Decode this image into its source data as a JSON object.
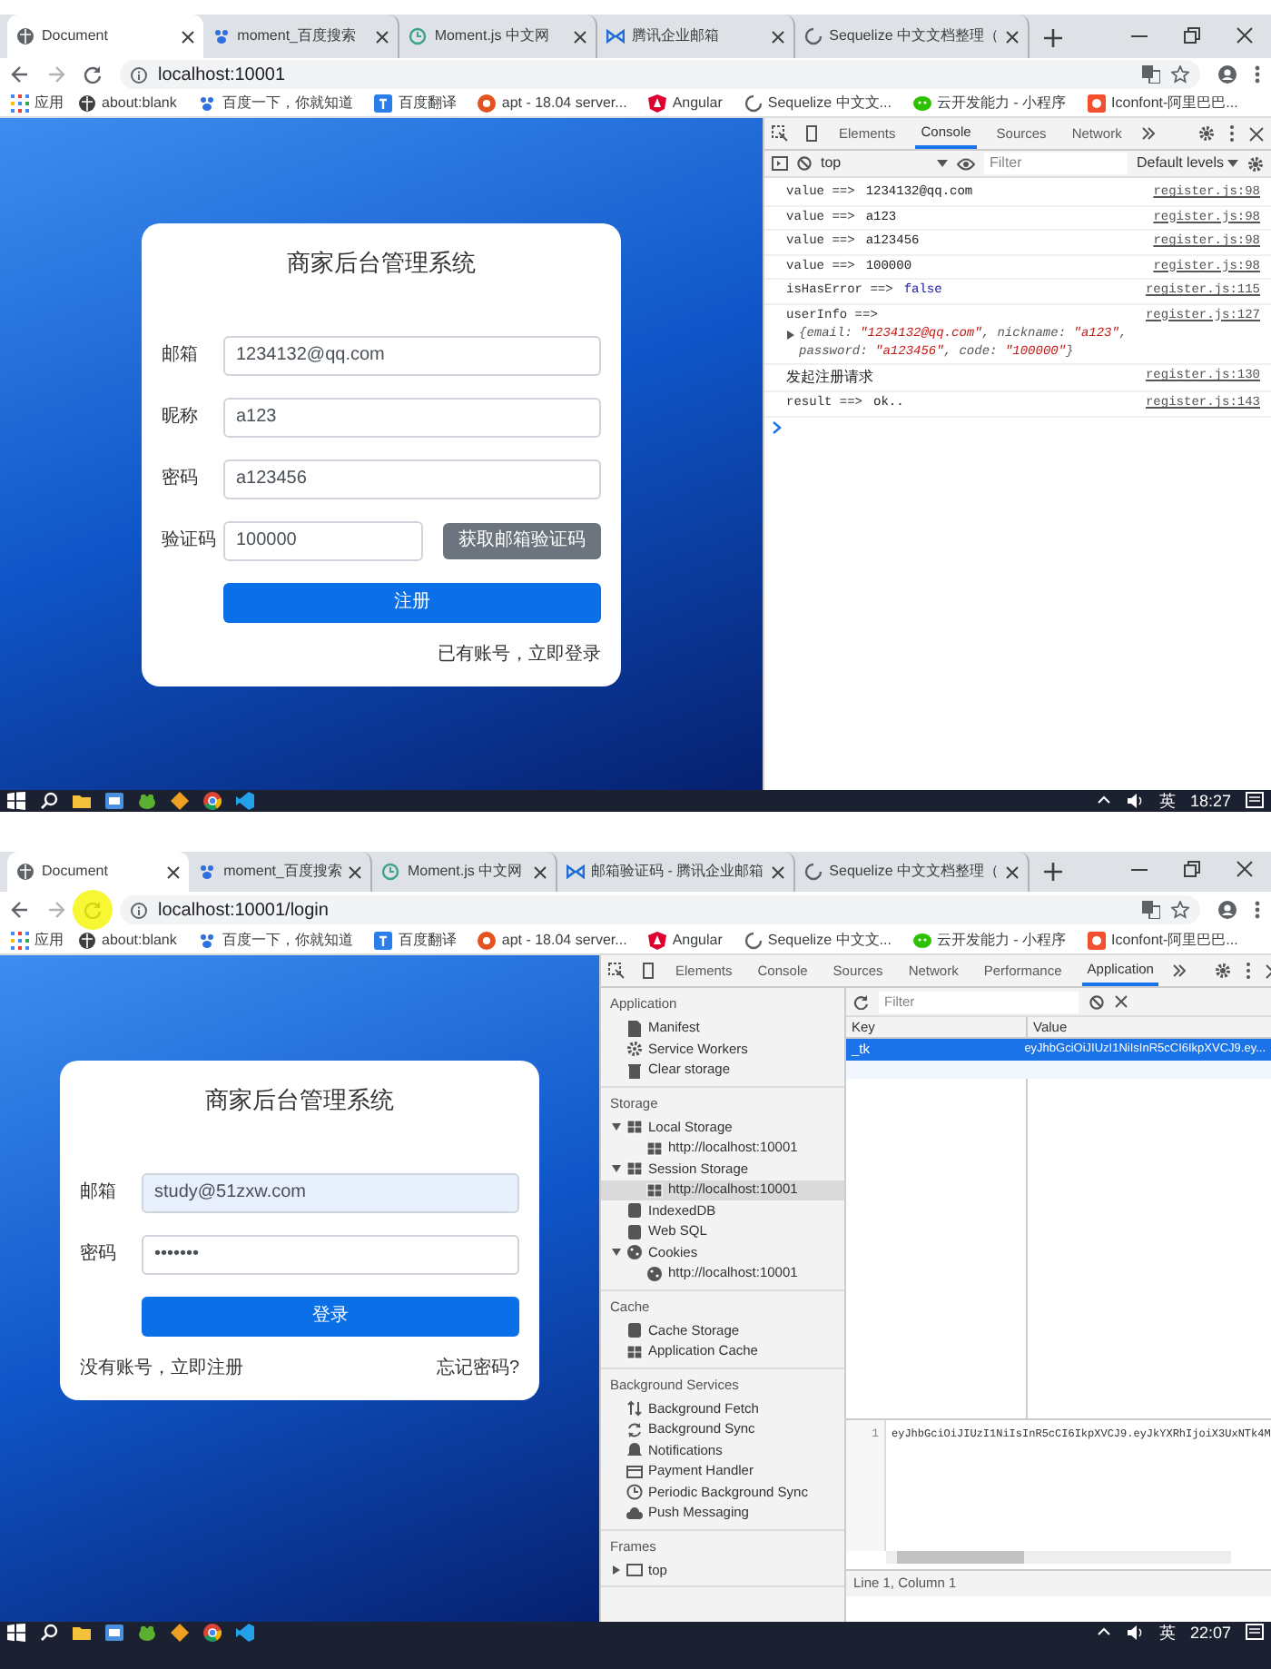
{
  "screens": [
    {
      "tabs": [
        {
          "label": "Document",
          "selected": true
        },
        {
          "label": "moment_百度搜索",
          "selected": false
        },
        {
          "label": "Moment.js 中文网",
          "selected": false
        },
        {
          "label": "腾讯企业邮箱",
          "selected": false
        },
        {
          "label": "Sequelize 中文文档整理（",
          "selected": false
        }
      ],
      "url": "localhost:10001",
      "cursor_highlight": false,
      "bookmarks": [
        "应用",
        "about:blank",
        "百度一下，你就知道",
        "百度翻译",
        "apt - 18.04 server...",
        "Angular",
        "Sequelize 中文文...",
        "云开发能力 - 小程序",
        "Iconfont-阿里巴巴..."
      ],
      "form": {
        "title": "商家后台管理系统",
        "fields": [
          {
            "kind": "text",
            "label": "邮箱",
            "value": "1234132@qq.com",
            "autofilled": false
          },
          {
            "kind": "text",
            "label": "昵称",
            "value": "a123",
            "autofilled": false
          },
          {
            "kind": "text",
            "label": "密码",
            "value": "a123456",
            "autofilled": false
          },
          {
            "kind": "code",
            "label": "验证码",
            "value": "100000",
            "button": "获取邮箱验证码",
            "autofilled": false
          }
        ],
        "submit": "注册",
        "links": [
          "已有账号，立即登录"
        ]
      },
      "devtools": {
        "kind": "console",
        "tabs": [
          {
            "label": "Elements",
            "selected": false
          },
          {
            "label": "Console",
            "selected": true
          },
          {
            "label": "Sources",
            "selected": false
          },
          {
            "label": "Network",
            "selected": false
          }
        ],
        "context": "top",
        "filter_placeholder": "Filter",
        "levels": "Default levels",
        "lines": [
          {
            "kind": "value",
            "label": "value ==>",
            "value": "1234132@qq.com",
            "source": "register.js:98"
          },
          {
            "kind": "value",
            "label": "value ==>",
            "value": "a123",
            "source": "register.js:98"
          },
          {
            "kind": "value",
            "label": "value ==>",
            "value": "a123456",
            "source": "register.js:98"
          },
          {
            "kind": "value",
            "label": "value ==>",
            "value": "100000",
            "source": "register.js:98"
          },
          {
            "kind": "boolean",
            "label": "isHasError ==>",
            "value": "false",
            "source": "register.js:115"
          },
          {
            "kind": "object",
            "label": "userInfo ==>",
            "expanded": false,
            "preview": "{email: \"1234132@qq.com\", nickname: \"a123\", password: \"a123456\", code: \"100000\"}",
            "source": "register.js:127"
          },
          {
            "kind": "message",
            "text": "发起注册请求",
            "source": "register.js:130"
          },
          {
            "kind": "value",
            "label": "result ==>",
            "value": "ok..",
            "source": "register.js:143"
          }
        ]
      },
      "taskbar": {
        "ime": "英",
        "time": "18:27"
      }
    },
    {
      "tabs": [
        {
          "label": "Document",
          "selected": true
        },
        {
          "label": "moment_百度搜索",
          "selected": false
        },
        {
          "label": "Moment.js 中文网",
          "selected": false
        },
        {
          "label": "邮箱验证码 - 腾讯企业邮箱",
          "selected": false
        },
        {
          "label": "Sequelize 中文文档整理（",
          "selected": false
        }
      ],
      "url": "localhost:10001/login",
      "cursor_highlight": true,
      "bookmarks": [
        "应用",
        "about:blank",
        "百度一下，你就知道",
        "百度翻译",
        "apt - 18.04 server...",
        "Angular",
        "Sequelize 中文文...",
        "云开发能力 - 小程序",
        "Iconfont-阿里巴巴..."
      ],
      "form": {
        "title": "商家后台管理系统",
        "fields": [
          {
            "kind": "text",
            "label": "邮箱",
            "value": "study@51zxw.com",
            "autofilled": true
          },
          {
            "kind": "password",
            "label": "密码",
            "value": "•••••••",
            "autofilled": false
          }
        ],
        "submit": "登录",
        "links": [
          "没有账号，立即注册",
          "忘记密码?"
        ]
      },
      "devtools": {
        "kind": "application",
        "tabs": [
          {
            "label": "Elements",
            "selected": false
          },
          {
            "label": "Console",
            "selected": false
          },
          {
            "label": "Sources",
            "selected": false
          },
          {
            "label": "Network",
            "selected": false
          },
          {
            "label": "Performance",
            "selected": false
          },
          {
            "label": "Application",
            "selected": true
          }
        ],
        "sections": [
          {
            "title": "Application",
            "items": [
              {
                "label": "Manifest",
                "selected": false
              },
              {
                "label": "Service Workers",
                "selected": false
              },
              {
                "label": "Clear storage",
                "selected": false
              }
            ]
          },
          {
            "title": "Storage",
            "items": [
              {
                "label": "Local Storage",
                "selected": false,
                "expanded": true,
                "children": [
                  {
                    "label": "http://localhost:10001",
                    "selected": false
                  }
                ]
              },
              {
                "label": "Session Storage",
                "selected": false,
                "expanded": true,
                "children": [
                  {
                    "label": "http://localhost:10001",
                    "selected": true
                  }
                ]
              },
              {
                "label": "IndexedDB",
                "selected": false
              },
              {
                "label": "Web SQL",
                "selected": false
              },
              {
                "label": "Cookies",
                "selected": false,
                "expanded": true,
                "children": [
                  {
                    "label": "http://localhost:10001",
                    "selected": false
                  }
                ]
              }
            ]
          },
          {
            "title": "Cache",
            "items": [
              {
                "label": "Cache Storage",
                "selected": false
              },
              {
                "label": "Application Cache",
                "selected": false
              }
            ]
          },
          {
            "title": "Background Services",
            "items": [
              {
                "label": "Background Fetch",
                "selected": false
              },
              {
                "label": "Background Sync",
                "selected": false
              },
              {
                "label": "Notifications",
                "selected": false
              },
              {
                "label": "Payment Handler",
                "selected": false
              },
              {
                "label": "Periodic Background Sync",
                "selected": false
              },
              {
                "label": "Push Messaging",
                "selected": false
              }
            ]
          },
          {
            "title": "Frames",
            "items": [
              {
                "label": "top",
                "selected": false,
                "expanded": false
              }
            ]
          }
        ],
        "filter_placeholder": "Filter",
        "columns": [
          "Key",
          "Value"
        ],
        "rows": [
          {
            "key": "_tk",
            "value": "eyJhbGciOiJIUzI1NiIsInR5cCI6IkpXVCJ9.ey...",
            "selected": true
          }
        ],
        "preview": {
          "line_number": "1",
          "text": "eyJhbGciOiJIUzI1NiIsInR5cCI6IkpXVCJ9.eyJkYXRhIjoiX3UxNTk4M"
        },
        "status": "Line 1, Column 1"
      },
      "taskbar": {
        "ime": "英",
        "time": "22:07"
      }
    }
  ]
}
